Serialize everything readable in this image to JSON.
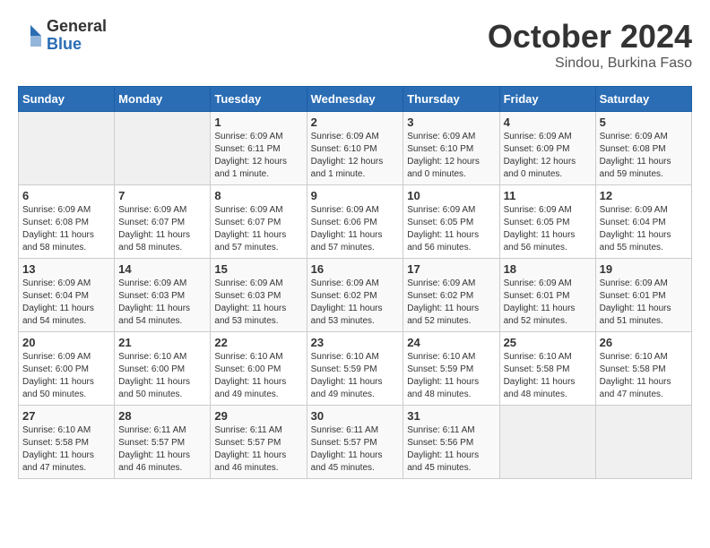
{
  "logo": {
    "general": "General",
    "blue": "Blue"
  },
  "header": {
    "month": "October 2024",
    "location": "Sindou, Burkina Faso"
  },
  "weekdays": [
    "Sunday",
    "Monday",
    "Tuesday",
    "Wednesday",
    "Thursday",
    "Friday",
    "Saturday"
  ],
  "weeks": [
    [
      {
        "day": "",
        "info": ""
      },
      {
        "day": "",
        "info": ""
      },
      {
        "day": "1",
        "info": "Sunrise: 6:09 AM\nSunset: 6:11 PM\nDaylight: 12 hours\nand 1 minute."
      },
      {
        "day": "2",
        "info": "Sunrise: 6:09 AM\nSunset: 6:10 PM\nDaylight: 12 hours\nand 1 minute."
      },
      {
        "day": "3",
        "info": "Sunrise: 6:09 AM\nSunset: 6:10 PM\nDaylight: 12 hours\nand 0 minutes."
      },
      {
        "day": "4",
        "info": "Sunrise: 6:09 AM\nSunset: 6:09 PM\nDaylight: 12 hours\nand 0 minutes."
      },
      {
        "day": "5",
        "info": "Sunrise: 6:09 AM\nSunset: 6:08 PM\nDaylight: 11 hours\nand 59 minutes."
      }
    ],
    [
      {
        "day": "6",
        "info": "Sunrise: 6:09 AM\nSunset: 6:08 PM\nDaylight: 11 hours\nand 58 minutes."
      },
      {
        "day": "7",
        "info": "Sunrise: 6:09 AM\nSunset: 6:07 PM\nDaylight: 11 hours\nand 58 minutes."
      },
      {
        "day": "8",
        "info": "Sunrise: 6:09 AM\nSunset: 6:07 PM\nDaylight: 11 hours\nand 57 minutes."
      },
      {
        "day": "9",
        "info": "Sunrise: 6:09 AM\nSunset: 6:06 PM\nDaylight: 11 hours\nand 57 minutes."
      },
      {
        "day": "10",
        "info": "Sunrise: 6:09 AM\nSunset: 6:05 PM\nDaylight: 11 hours\nand 56 minutes."
      },
      {
        "day": "11",
        "info": "Sunrise: 6:09 AM\nSunset: 6:05 PM\nDaylight: 11 hours\nand 56 minutes."
      },
      {
        "day": "12",
        "info": "Sunrise: 6:09 AM\nSunset: 6:04 PM\nDaylight: 11 hours\nand 55 minutes."
      }
    ],
    [
      {
        "day": "13",
        "info": "Sunrise: 6:09 AM\nSunset: 6:04 PM\nDaylight: 11 hours\nand 54 minutes."
      },
      {
        "day": "14",
        "info": "Sunrise: 6:09 AM\nSunset: 6:03 PM\nDaylight: 11 hours\nand 54 minutes."
      },
      {
        "day": "15",
        "info": "Sunrise: 6:09 AM\nSunset: 6:03 PM\nDaylight: 11 hours\nand 53 minutes."
      },
      {
        "day": "16",
        "info": "Sunrise: 6:09 AM\nSunset: 6:02 PM\nDaylight: 11 hours\nand 53 minutes."
      },
      {
        "day": "17",
        "info": "Sunrise: 6:09 AM\nSunset: 6:02 PM\nDaylight: 11 hours\nand 52 minutes."
      },
      {
        "day": "18",
        "info": "Sunrise: 6:09 AM\nSunset: 6:01 PM\nDaylight: 11 hours\nand 52 minutes."
      },
      {
        "day": "19",
        "info": "Sunrise: 6:09 AM\nSunset: 6:01 PM\nDaylight: 11 hours\nand 51 minutes."
      }
    ],
    [
      {
        "day": "20",
        "info": "Sunrise: 6:09 AM\nSunset: 6:00 PM\nDaylight: 11 hours\nand 50 minutes."
      },
      {
        "day": "21",
        "info": "Sunrise: 6:10 AM\nSunset: 6:00 PM\nDaylight: 11 hours\nand 50 minutes."
      },
      {
        "day": "22",
        "info": "Sunrise: 6:10 AM\nSunset: 6:00 PM\nDaylight: 11 hours\nand 49 minutes."
      },
      {
        "day": "23",
        "info": "Sunrise: 6:10 AM\nSunset: 5:59 PM\nDaylight: 11 hours\nand 49 minutes."
      },
      {
        "day": "24",
        "info": "Sunrise: 6:10 AM\nSunset: 5:59 PM\nDaylight: 11 hours\nand 48 minutes."
      },
      {
        "day": "25",
        "info": "Sunrise: 6:10 AM\nSunset: 5:58 PM\nDaylight: 11 hours\nand 48 minutes."
      },
      {
        "day": "26",
        "info": "Sunrise: 6:10 AM\nSunset: 5:58 PM\nDaylight: 11 hours\nand 47 minutes."
      }
    ],
    [
      {
        "day": "27",
        "info": "Sunrise: 6:10 AM\nSunset: 5:58 PM\nDaylight: 11 hours\nand 47 minutes."
      },
      {
        "day": "28",
        "info": "Sunrise: 6:11 AM\nSunset: 5:57 PM\nDaylight: 11 hours\nand 46 minutes."
      },
      {
        "day": "29",
        "info": "Sunrise: 6:11 AM\nSunset: 5:57 PM\nDaylight: 11 hours\nand 46 minutes."
      },
      {
        "day": "30",
        "info": "Sunrise: 6:11 AM\nSunset: 5:57 PM\nDaylight: 11 hours\nand 45 minutes."
      },
      {
        "day": "31",
        "info": "Sunrise: 6:11 AM\nSunset: 5:56 PM\nDaylight: 11 hours\nand 45 minutes."
      },
      {
        "day": "",
        "info": ""
      },
      {
        "day": "",
        "info": ""
      }
    ]
  ]
}
